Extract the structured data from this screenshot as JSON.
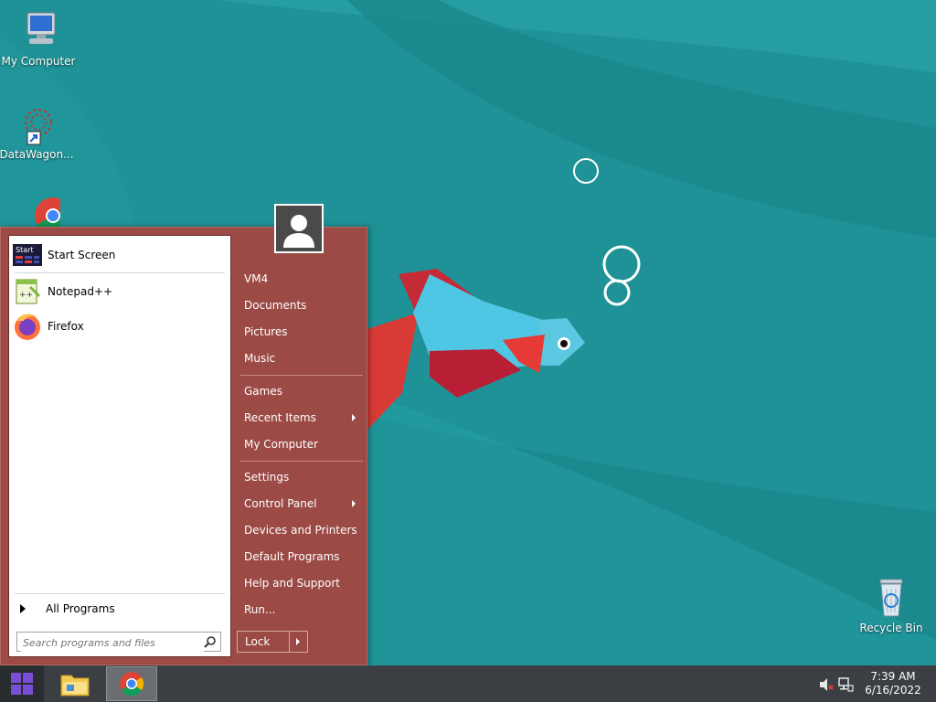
{
  "desktop": {
    "icons": [
      {
        "label": "My Computer",
        "icon": "computer-icon"
      },
      {
        "label": "DataWagon...",
        "icon": "datawagon-shortcut-icon"
      },
      {
        "label": "",
        "icon": "chrome-icon"
      },
      {
        "label": "Recycle Bin",
        "icon": "recycle-bin-icon"
      }
    ]
  },
  "start_menu": {
    "pinned": [
      {
        "label": "Start Screen",
        "icon": "start-screen-icon"
      },
      {
        "label": "Notepad++",
        "icon": "notepad-plus-plus-icon"
      },
      {
        "label": "Firefox",
        "icon": "firefox-icon"
      }
    ],
    "all_programs": "All Programs",
    "search_placeholder": "Search programs and files",
    "right_items": [
      {
        "label": "VM4"
      },
      {
        "label": "Documents"
      },
      {
        "label": "Pictures"
      },
      {
        "label": "Music"
      },
      {
        "label": "Games"
      },
      {
        "label": "Recent Items",
        "submenu": true
      },
      {
        "label": "My Computer"
      },
      {
        "label": "Settings"
      },
      {
        "label": "Control Panel",
        "submenu": true
      },
      {
        "label": "Devices and Printers"
      },
      {
        "label": "Default Programs"
      },
      {
        "label": "Help and Support"
      },
      {
        "label": "Run..."
      }
    ],
    "lock_label": "Lock",
    "colors": {
      "panel": "#9b4a45",
      "accent": "#c98a85"
    }
  },
  "taskbar": {
    "apps": [
      {
        "name": "File Explorer",
        "icon": "folder-icon"
      },
      {
        "name": "Google Chrome",
        "icon": "chrome-icon",
        "active": true
      }
    ],
    "tray": {
      "volume_icon": "volume-muted-icon",
      "network_icon": "network-icon"
    },
    "time": "7:39 AM",
    "date": "6/16/2022"
  }
}
